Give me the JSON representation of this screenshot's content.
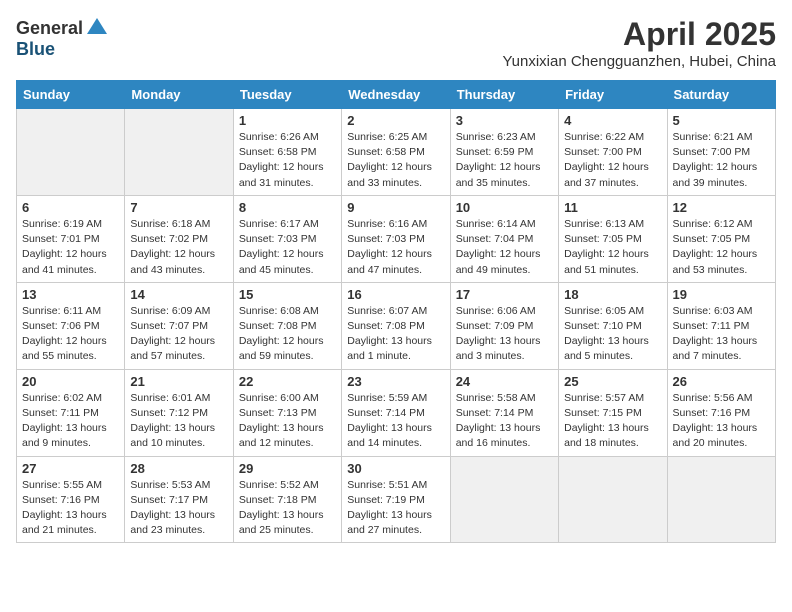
{
  "logo": {
    "general": "General",
    "blue": "Blue"
  },
  "title": "April 2025",
  "subtitle": "Yunxixian Chengguanzhen, Hubei, China",
  "days_of_week": [
    "Sunday",
    "Monday",
    "Tuesday",
    "Wednesday",
    "Thursday",
    "Friday",
    "Saturday"
  ],
  "weeks": [
    [
      {
        "day": "",
        "info": ""
      },
      {
        "day": "",
        "info": ""
      },
      {
        "day": "1",
        "info": "Sunrise: 6:26 AM\nSunset: 6:58 PM\nDaylight: 12 hours\nand 31 minutes."
      },
      {
        "day": "2",
        "info": "Sunrise: 6:25 AM\nSunset: 6:58 PM\nDaylight: 12 hours\nand 33 minutes."
      },
      {
        "day": "3",
        "info": "Sunrise: 6:23 AM\nSunset: 6:59 PM\nDaylight: 12 hours\nand 35 minutes."
      },
      {
        "day": "4",
        "info": "Sunrise: 6:22 AM\nSunset: 7:00 PM\nDaylight: 12 hours\nand 37 minutes."
      },
      {
        "day": "5",
        "info": "Sunrise: 6:21 AM\nSunset: 7:00 PM\nDaylight: 12 hours\nand 39 minutes."
      }
    ],
    [
      {
        "day": "6",
        "info": "Sunrise: 6:19 AM\nSunset: 7:01 PM\nDaylight: 12 hours\nand 41 minutes."
      },
      {
        "day": "7",
        "info": "Sunrise: 6:18 AM\nSunset: 7:02 PM\nDaylight: 12 hours\nand 43 minutes."
      },
      {
        "day": "8",
        "info": "Sunrise: 6:17 AM\nSunset: 7:03 PM\nDaylight: 12 hours\nand 45 minutes."
      },
      {
        "day": "9",
        "info": "Sunrise: 6:16 AM\nSunset: 7:03 PM\nDaylight: 12 hours\nand 47 minutes."
      },
      {
        "day": "10",
        "info": "Sunrise: 6:14 AM\nSunset: 7:04 PM\nDaylight: 12 hours\nand 49 minutes."
      },
      {
        "day": "11",
        "info": "Sunrise: 6:13 AM\nSunset: 7:05 PM\nDaylight: 12 hours\nand 51 minutes."
      },
      {
        "day": "12",
        "info": "Sunrise: 6:12 AM\nSunset: 7:05 PM\nDaylight: 12 hours\nand 53 minutes."
      }
    ],
    [
      {
        "day": "13",
        "info": "Sunrise: 6:11 AM\nSunset: 7:06 PM\nDaylight: 12 hours\nand 55 minutes."
      },
      {
        "day": "14",
        "info": "Sunrise: 6:09 AM\nSunset: 7:07 PM\nDaylight: 12 hours\nand 57 minutes."
      },
      {
        "day": "15",
        "info": "Sunrise: 6:08 AM\nSunset: 7:08 PM\nDaylight: 12 hours\nand 59 minutes."
      },
      {
        "day": "16",
        "info": "Sunrise: 6:07 AM\nSunset: 7:08 PM\nDaylight: 13 hours\nand 1 minute."
      },
      {
        "day": "17",
        "info": "Sunrise: 6:06 AM\nSunset: 7:09 PM\nDaylight: 13 hours\nand 3 minutes."
      },
      {
        "day": "18",
        "info": "Sunrise: 6:05 AM\nSunset: 7:10 PM\nDaylight: 13 hours\nand 5 minutes."
      },
      {
        "day": "19",
        "info": "Sunrise: 6:03 AM\nSunset: 7:11 PM\nDaylight: 13 hours\nand 7 minutes."
      }
    ],
    [
      {
        "day": "20",
        "info": "Sunrise: 6:02 AM\nSunset: 7:11 PM\nDaylight: 13 hours\nand 9 minutes."
      },
      {
        "day": "21",
        "info": "Sunrise: 6:01 AM\nSunset: 7:12 PM\nDaylight: 13 hours\nand 10 minutes."
      },
      {
        "day": "22",
        "info": "Sunrise: 6:00 AM\nSunset: 7:13 PM\nDaylight: 13 hours\nand 12 minutes."
      },
      {
        "day": "23",
        "info": "Sunrise: 5:59 AM\nSunset: 7:14 PM\nDaylight: 13 hours\nand 14 minutes."
      },
      {
        "day": "24",
        "info": "Sunrise: 5:58 AM\nSunset: 7:14 PM\nDaylight: 13 hours\nand 16 minutes."
      },
      {
        "day": "25",
        "info": "Sunrise: 5:57 AM\nSunset: 7:15 PM\nDaylight: 13 hours\nand 18 minutes."
      },
      {
        "day": "26",
        "info": "Sunrise: 5:56 AM\nSunset: 7:16 PM\nDaylight: 13 hours\nand 20 minutes."
      }
    ],
    [
      {
        "day": "27",
        "info": "Sunrise: 5:55 AM\nSunset: 7:16 PM\nDaylight: 13 hours\nand 21 minutes."
      },
      {
        "day": "28",
        "info": "Sunrise: 5:53 AM\nSunset: 7:17 PM\nDaylight: 13 hours\nand 23 minutes."
      },
      {
        "day": "29",
        "info": "Sunrise: 5:52 AM\nSunset: 7:18 PM\nDaylight: 13 hours\nand 25 minutes."
      },
      {
        "day": "30",
        "info": "Sunrise: 5:51 AM\nSunset: 7:19 PM\nDaylight: 13 hours\nand 27 minutes."
      },
      {
        "day": "",
        "info": ""
      },
      {
        "day": "",
        "info": ""
      },
      {
        "day": "",
        "info": ""
      }
    ]
  ]
}
